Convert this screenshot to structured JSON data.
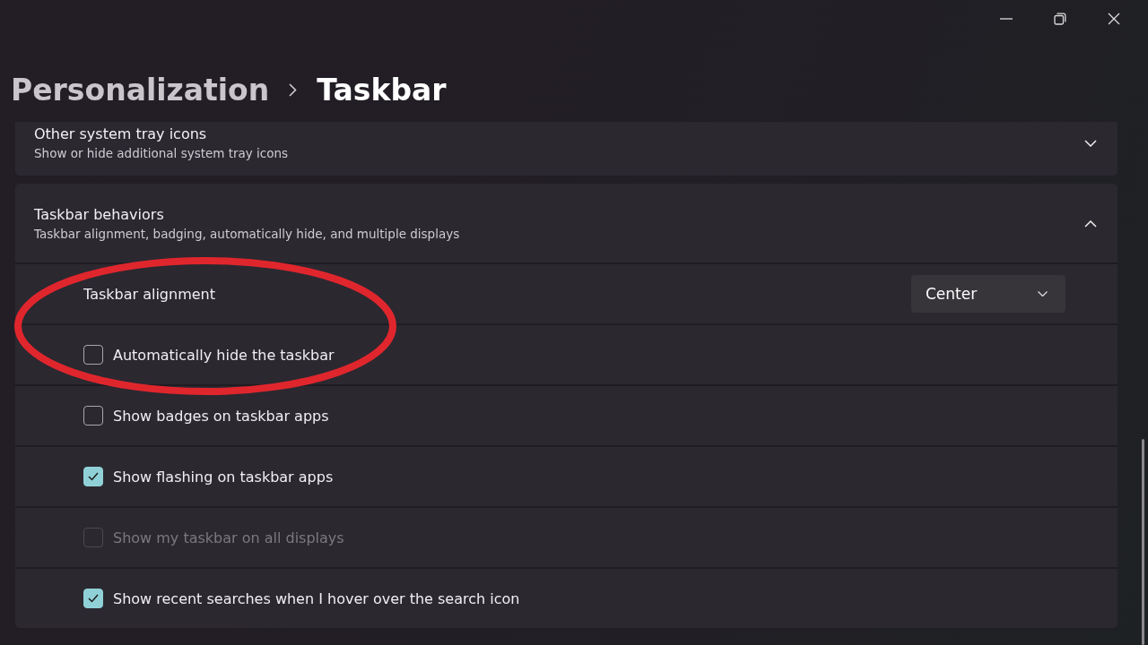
{
  "breadcrumb": {
    "parent": "Personalization",
    "current": "Taskbar"
  },
  "sections": [
    {
      "title": "Other system tray icons",
      "subtitle": "Show or hide additional system tray icons",
      "expanded": false
    },
    {
      "title": "Taskbar behaviors",
      "subtitle": "Taskbar alignment, badging, automatically hide, and multiple displays",
      "expanded": true,
      "rows": [
        {
          "kind": "dropdown",
          "label": "Taskbar alignment",
          "value": "Center"
        },
        {
          "kind": "checkbox",
          "label": "Automatically hide the taskbar",
          "checked": false,
          "disabled": false
        },
        {
          "kind": "checkbox",
          "label": "Show badges on taskbar apps",
          "checked": false,
          "disabled": false
        },
        {
          "kind": "checkbox",
          "label": "Show flashing on taskbar apps",
          "checked": true,
          "disabled": false
        },
        {
          "kind": "checkbox",
          "label": "Show my taskbar on all displays",
          "checked": false,
          "disabled": true
        },
        {
          "kind": "checkbox",
          "label": "Show recent searches when I hover over the search icon",
          "checked": true,
          "disabled": false
        }
      ]
    }
  ]
}
